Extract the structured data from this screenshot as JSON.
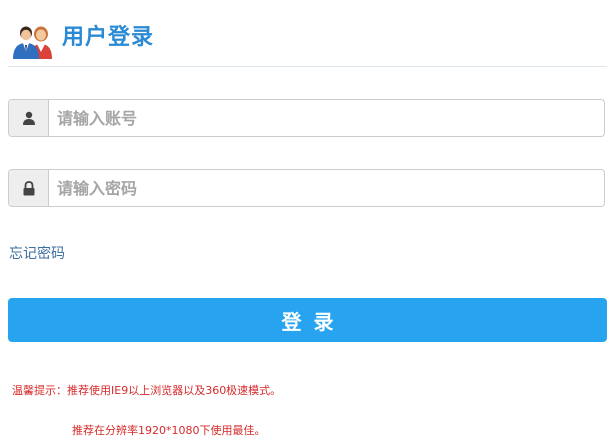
{
  "header": {
    "icon": "users-icon",
    "title": "用户登录"
  },
  "form": {
    "username": {
      "icon": "user-icon",
      "placeholder": "请输入账号",
      "value": ""
    },
    "password": {
      "icon": "lock-icon",
      "placeholder": "请输入密码",
      "value": ""
    },
    "forgot_label": "忘记密码",
    "login_label": "登录"
  },
  "tips": {
    "line1": "温馨提示：推荐使用IE9以上浏览器以及360极速模式。",
    "line2": "推荐在分辨率1920*1080下使用最佳。"
  },
  "colors": {
    "title": "#2a8ad4",
    "button": "#28a3ef",
    "link": "#3c6e9e",
    "tip": "#d62b2b"
  }
}
